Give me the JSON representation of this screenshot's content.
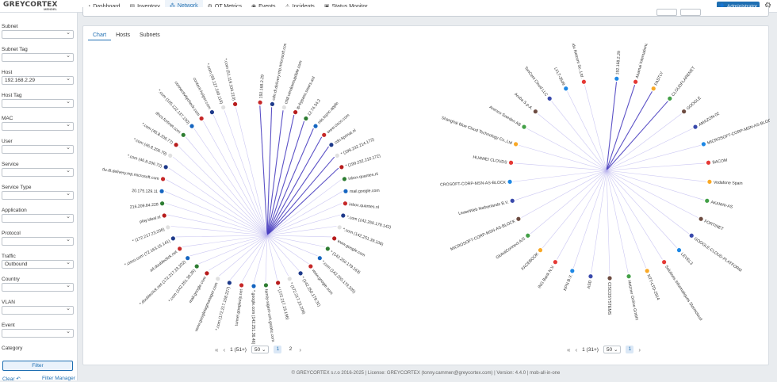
{
  "app": {
    "logo_main": "GREYCORTEX",
    "logo_sub": "MENDEL"
  },
  "nav": [
    {
      "label": "Dashboard",
      "icon": "dashboard-icon",
      "glyph": "◔"
    },
    {
      "label": "Inventory",
      "icon": "inventory-icon",
      "glyph": "▤"
    },
    {
      "label": "Network",
      "icon": "network-icon",
      "glyph": "⁂"
    },
    {
      "label": "OT Metrics",
      "icon": "ot-metrics-icon",
      "glyph": "⚙"
    },
    {
      "label": "Events",
      "icon": "events-icon",
      "glyph": "◉"
    },
    {
      "label": "Incidents",
      "icon": "incidents-icon",
      "glyph": "⚠"
    },
    {
      "label": "Status Monitor",
      "icon": "status-monitor-icon",
      "glyph": "▣"
    }
  ],
  "active_nav": "Network",
  "user": {
    "label": "Administrator"
  },
  "filters": [
    {
      "label": "Subnet",
      "value": ""
    },
    {
      "label": "Subnet Tag",
      "value": ""
    },
    {
      "label": "Host",
      "value": "192.168.2.29"
    },
    {
      "label": "Host Tag",
      "value": ""
    },
    {
      "label": "MAC",
      "value": ""
    },
    {
      "label": "User",
      "value": ""
    },
    {
      "label": "Service",
      "value": ""
    },
    {
      "label": "Service Type",
      "value": ""
    },
    {
      "label": "Application",
      "value": ""
    },
    {
      "label": "Protocol",
      "value": ""
    },
    {
      "label": "Traffic",
      "value": "Outbound"
    },
    {
      "label": "Country",
      "value": ""
    },
    {
      "label": "VLAN",
      "value": ""
    },
    {
      "label": "Event",
      "value": ""
    },
    {
      "label": "Category",
      "value": ""
    }
  ],
  "filter_button": "Filter",
  "clear_link": "Clear",
  "filter_manager_link": "Filter Manager",
  "tabs": [
    "Chart",
    "Hosts",
    "Subnets"
  ],
  "active_tab": "Chart",
  "left_graph": {
    "center": "192.168.2.29",
    "nodes": [
      "192.168.2.29",
      "cdn.dl.delivery.mp.microsoft.com",
      "ctldl.windowsupdate.com",
      "ip-bypass.sewrs.aol",
      "12.74.34.2",
      "mls.tsync.apple",
      "www.cisco.com",
      "cdn.kprinat.nl",
      "* (199.232.214.172)",
      "* (199.232.210.172)",
      "inbox.quantes.nl",
      "mail.google.com",
      "inbox.quantes.nl",
      "*.com (142.250.179.142)",
      "*.com (142.251.39.106)",
      "www.google.com",
      "* (142.250.179.163)",
      "*.com (142.250.179.205)",
      "www.google.com",
      "* (142.250.179.31)",
      "* (172.217.23.206)",
      "* (172.217.23.196)",
      "family-sigent-unit.gstatic.com",
      "*.google.com (142.251.36.46)",
      "tunnel.googlezip.net",
      "*.com (172.217.168.227)",
      "www.googletagmanager.com",
      "mail.google.com",
      "*.com (142.251.36.35)",
      "*.doubleclick.net (172.217.23.202)",
      "ad.doubleclick.net",
      "*.cisco.com (72.163.15.141)",
      "* (172.217.23.206)",
      "play.ideal.nl",
      "216.209.84.228",
      "20.175.129.11",
      "tlu.dl.delivery.mp.microsoft.com",
      "*.com (46.8.206.72)",
      "*.com (46.8.206.79)",
      "*.com (46.8.206.77)",
      "dhcs.fortinet.com",
      "*.com (165.122.137.100)",
      "connectivitycheck.com",
      "content-helper.com",
      "*.com (65.127.240.119)",
      "*.com (51.119.104.210)"
    ]
  },
  "right_graph": {
    "center": "192.168.2.29",
    "nodes": [
      "192.168.2.29",
      "Akamai International B.V.",
      "FASTLY",
      "CLOUDFLARENET",
      "GOOGLE",
      "AMAZON-02",
      "MICROSOFT-CORP-MSN-AS-BLOCK",
      "BACOM",
      "Vodafone Spain",
      "AKAMAI-AS",
      "FORTINET",
      "GOOGLE-CLOUD-PLATFORM",
      "LEVEL3",
      "Solutions Informatiques Stormcloud",
      "NTT-LTD-2914",
      "Hetzner Online GmbH",
      "CISCOSYSTEMS",
      "ASD",
      "KPN B.V.",
      "ING Bank N.V.",
      "FACEBOOK",
      "GlobalConnect A/S",
      "MICROSOFT-CORP-MSN-AS-BLOCK",
      "LeaseWeb Netherlands B.V.",
      "CROSOFT-CORP-MSN-AS-BLOCK",
      "HUAWEI CLOUDS",
      "Shanghai Blue Cloud Technology Co.,Ltd",
      "Avenco Sweden AB",
      "Aruba S.p.A.",
      "TenCent Cloud LLC",
      "LVLT-3549",
      "Beijing Baidu Netcom Sc.,Ltd."
    ]
  },
  "left_pager": {
    "range": "1 (51+)",
    "per_page": "50",
    "pages": [
      "1",
      "2"
    ],
    "current": "1"
  },
  "right_pager": {
    "range": "1 (31+)",
    "per_page": "50",
    "pages": [
      "1"
    ],
    "current": "1"
  },
  "footer": "© GREYCORTEX s.r.o 2016-2025 | License: GREYCORTEX (tonny.cammen@greycortex.com) | Version: 4.4.0 | mob-all-in-one",
  "colors": {
    "accent": "#1f6fb2",
    "edge": "#b9b4ee",
    "edge_strong": "#4a3fc0"
  }
}
